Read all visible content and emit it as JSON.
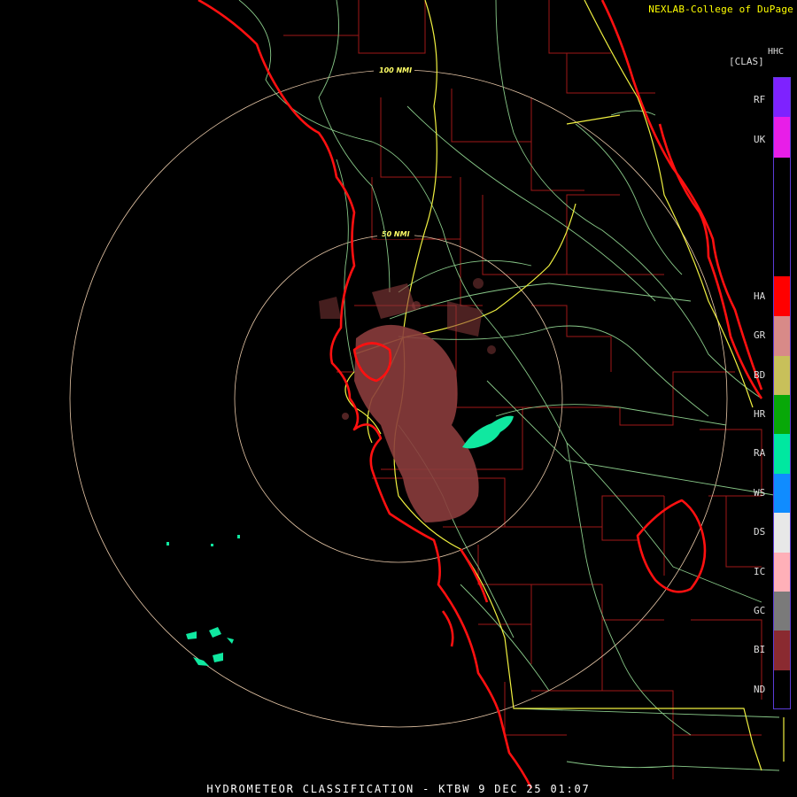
{
  "header": {
    "credit": "NEXLAB-College of DuPage",
    "product_code": "HHC",
    "product_tag": "[CLAS]"
  },
  "rings": [
    {
      "label": "100 NMI"
    },
    {
      "label": "50 NMI"
    }
  ],
  "legend": {
    "border_color": "#5b3cd8",
    "entries": [
      {
        "label": "RF",
        "color": "#7e22ff"
      },
      {
        "label": "UK",
        "color": "#e81ee8"
      },
      {
        "label": "HA",
        "color": "#ff0000"
      },
      {
        "label": "GR",
        "color": "#d88a88"
      },
      {
        "label": "BD",
        "color": "#c8c05a"
      },
      {
        "label": "HR",
        "color": "#08a808"
      },
      {
        "label": "RA",
        "color": "#00e8a0"
      },
      {
        "label": "WS",
        "color": "#108cff"
      },
      {
        "label": "DS",
        "color": "#e8e8e8"
      },
      {
        "label": "IC",
        "color": "#ffb0b8"
      },
      {
        "label": "GC",
        "color": "#7a7a7a"
      },
      {
        "label": "BI",
        "color": "#8a2a30"
      },
      {
        "label": "ND",
        "color": "#000000"
      }
    ]
  },
  "caption": "HYDROMETEOR CLASSIFICATION - KTBW 9 DEC 25 01:07",
  "map_colors": {
    "coastline": "#ff1010",
    "counties": "#a01818",
    "highways": "#f0f040",
    "roads": "#88c888",
    "rings": "#e8c8a8",
    "biological": "#8a3c3c",
    "rain": "#10e8a0"
  }
}
